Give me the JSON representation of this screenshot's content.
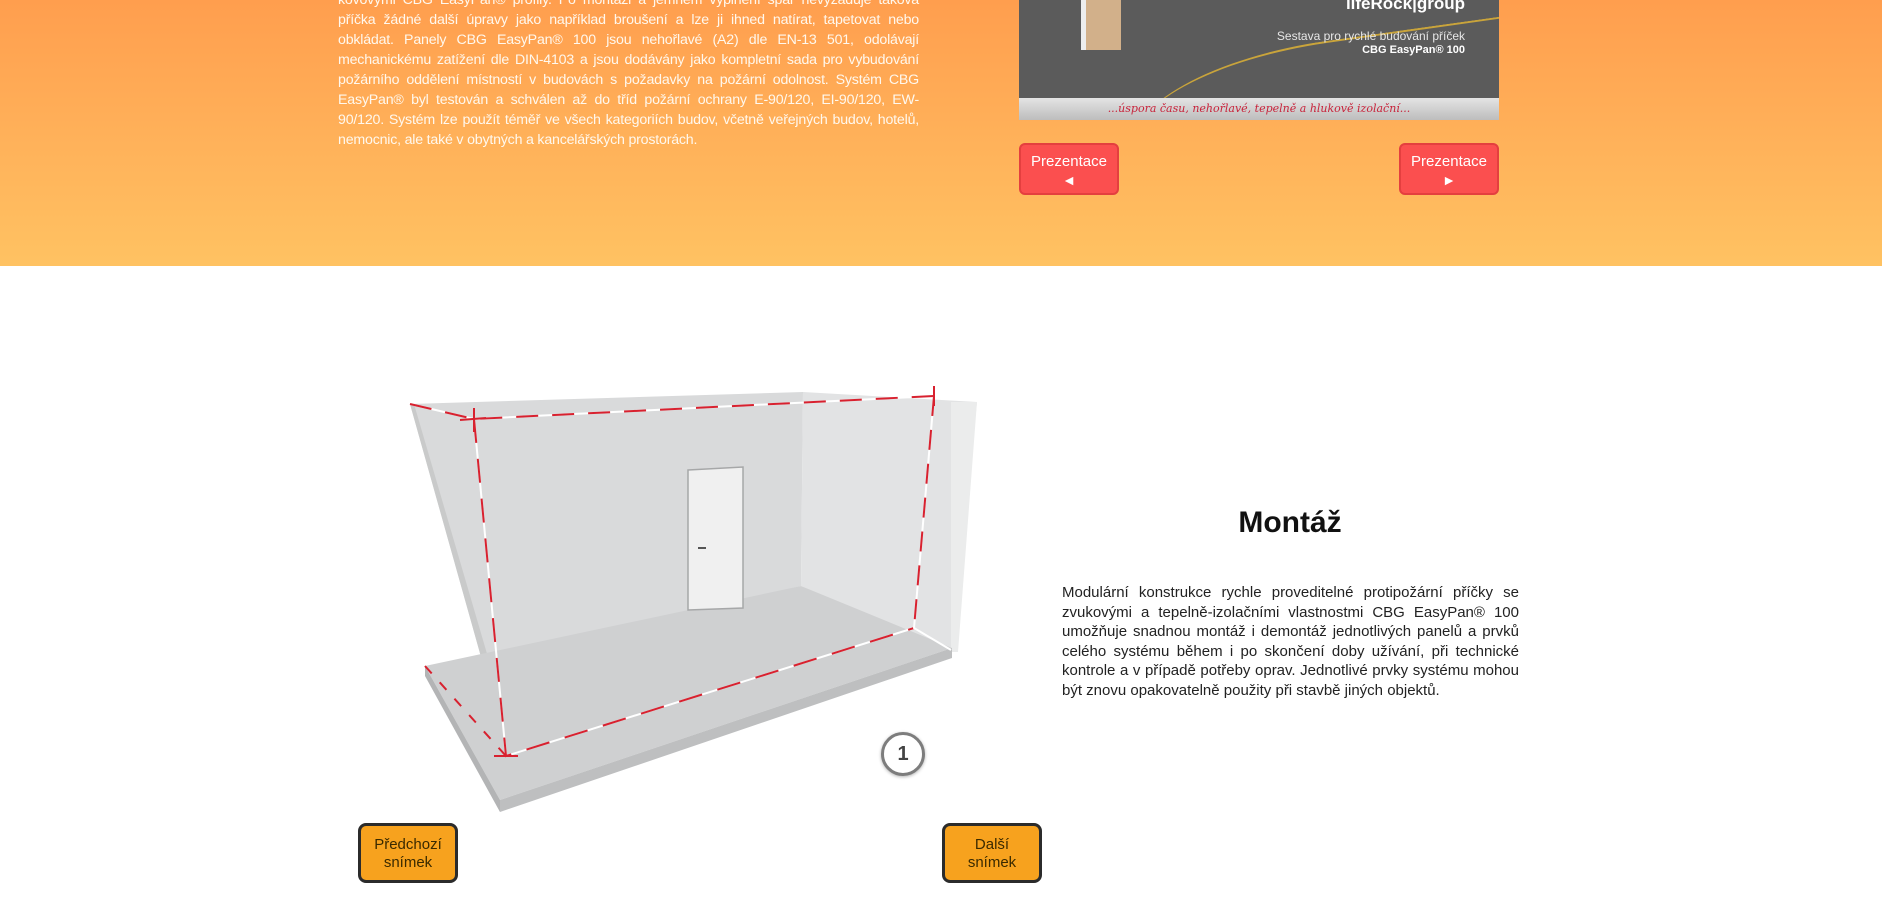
{
  "hero": {
    "paragraph": "kovovými CBG EasyPan® profily. Po montáži a jemném vyplnění spár nevyžaduje taková příčka žádné další úpravy jako například broušení a lze ji ihned natírat, tapetovat nebo obkládat. Panely CBG EasyPan® 100 jsou nehořlavé (A2) dle EN-13 501, odolávají mechanickému zatížení dle DIN-4103 a jsou dodávány jako kompletní sada pro vybudování požárního oddělení místností v budovách s požadavky na požární odolnost. Systém CBG EasyPan® byl testován a schválen až do tříd požární ochrany E-90/120, EI-90/120, EW-90/120. Systém lze použít téměř ve všech kategoriích budov, včetně veřejných budov, hotelů, nemocnic, ale také v obytných a kancelářských prostorách."
  },
  "slide": {
    "brand": "lifeRock|group",
    "subtitle": "Sestava pro rychlé budování příček",
    "product": "CBG EasyPan® 100",
    "strip": "...úspora času, nehořlavé, tepelně a hlukově izolační..."
  },
  "presentation": {
    "prev_label": "Prezentace",
    "prev_arrow": "◄",
    "next_label": "Prezentace",
    "next_arrow": "►"
  },
  "gallery": {
    "counter": "1",
    "prev_line1": "Předchozí",
    "prev_line2": "snímek",
    "next_line1": "Další",
    "next_line2": "snímek"
  },
  "montaz": {
    "title": "Montáž",
    "text": "Modulární konstrukce rychle proveditelné protipožární příčky se zvukovými a tepelně-izolačními vlastnostmi CBG EasyPan® 100 umožňuje snadnou montáž i demontáž jednotlivých panelů a prvků celého systému během i po skončení doby užívání, při technické kontrole a v případě potřeby oprav. Jednotlivé prvky systému mohou být znovu opakovatelně použity při stavbě jiných objektů."
  },
  "colors": {
    "hero_top": "#ff9e4e",
    "hero_bottom": "#ffc262",
    "red_button": "#fb4f4f",
    "orange_button": "#f7a21e"
  }
}
